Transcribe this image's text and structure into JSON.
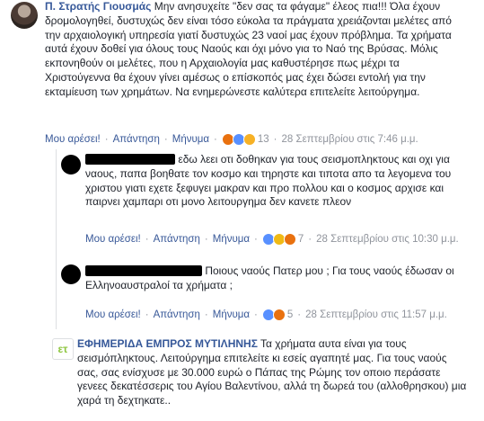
{
  "comments": [
    {
      "author": "Π. Στρατής Γιουσμάς",
      "text": "Μην ανησυχείτε \"δεν σας τα φάγαμε\" έλεος πια!!! Όλα έχουν δρομολογηθεί, δυστυχώς δεν είναι τόσο εύκολα τα πράγματα χρειάζονται μελέτες από την αρχαιολογική υπηρεσία γιατί δυστυχώς 23 ναοί μας έχουν πρόβλημα. Τα χρήματα αυτά έχουν δοθεί για όλους τους Ναούς και όχι μόνο για το Ναό της Βρύσας. Μόλις εκπονηθούν οι μελέτες, που η Αρχαιολογία μας καθυστέρησε πως μέχρι τα Χριστούγεννα θα έχουν γίνει αμέσως ο επίσκοπός μας έχει δώσει εντολή για την εκταμίευση των χρημάτων. Να ενημερώνεστε καλύτερα επιτελείτε λειτούργημα.",
      "like_label": "Μου αρέσει!",
      "reply_label": "Απάντηση",
      "message_label": "Μήνυμα",
      "reaction_count": "13",
      "timestamp": "28 Σεπτεμβρίου στις 7:46 μ.μ."
    },
    {
      "author": "",
      "text": "εδω λεει οτι δοθηκαν για τους σεισμοπληκτους και οχι για ναους, παπα βοηθατε τον κοσμο και τηρηστε και τιποτα απο τα λεγομενα του χριστου γιατι εχετε ξεφυγει μακραν και προ πολλου και ο κοσμος αρχισε και παιρνει χαμπαρι οτι μονο λειτουργημα δεν κανετε πλεον",
      "like_label": "Μου αρέσει!",
      "reply_label": "Απάντηση",
      "message_label": "Μήνυμα",
      "reaction_count": "7",
      "timestamp": "28 Σεπτεμβρίου στις 10:30 μ.μ."
    },
    {
      "author": "",
      "text": "Ποιους ναούς Πατερ μου ; Για τους ναούς έδωσαν οι Ελληνοαυστραλοί τα χρήματα ;",
      "like_label": "Μου αρέσει!",
      "reply_label": "Απάντηση",
      "message_label": "Μήνυμα",
      "reaction_count": "5",
      "timestamp": "28 Σεπτεμβρίου στις 11:57 μ.μ."
    },
    {
      "author": "ΕΦΗΜΕΡΙΔΑ ΕΜΠΡΟΣ ΜΥΤΙΛΗΝΗΣ",
      "text": "Τα χρήματα αυτα είναι για τους σεισμόπληκτους. Λειτούργημα επιτελείτε κι εσείς αγαπητέ μας. Για τους ναούς σας, σας ενίσχυσε με 30.000 ευρώ ο Πάπας της Ρώμης τον οποιο περάσατε γενεες δεκατέσσερις του Αγίου Βαλεντίνου, αλλά τη δωρεά του (αλλοθρησκου) μια χαρά τη δεχτηκατε.."
    }
  ],
  "icons": {
    "page_logo_text": "ετ"
  },
  "colors": {
    "link": "#365899",
    "meta": "#90949c",
    "logo_green": "#8dc63f"
  }
}
